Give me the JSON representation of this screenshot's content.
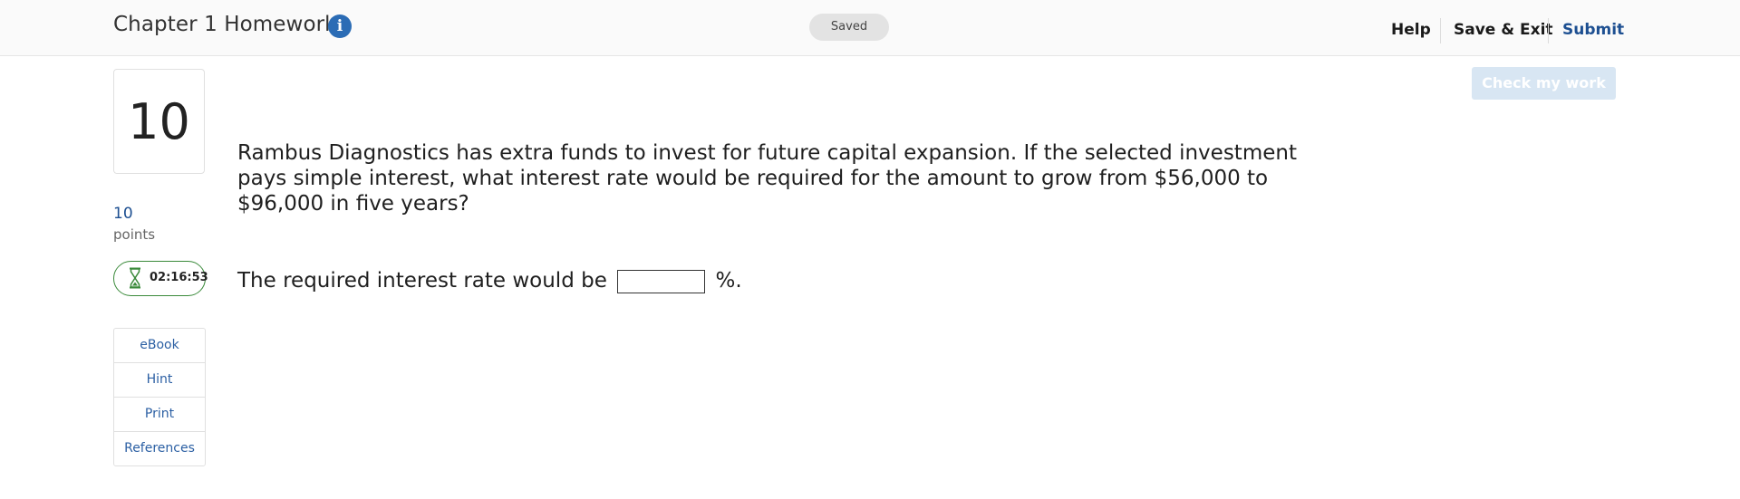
{
  "header": {
    "title": "Chapter 1 Homework",
    "info_icon": "info-icon",
    "status": "Saved",
    "links": {
      "help": "Help",
      "save_exit": "Save & Exit",
      "submit": "Submit"
    }
  },
  "question_panel": {
    "number": "10",
    "points_value": "10",
    "points_label": "points",
    "timer": "02:16:53",
    "timer_icon": "hourglass-icon",
    "tools": [
      "eBook",
      "Hint",
      "Print",
      "References"
    ]
  },
  "check_button": "Check my work",
  "question": {
    "text": "Rambus Diagnostics has extra funds to invest for future capital expansion. If the selected investment pays simple interest, what interest rate would be required for the amount to grow from $56,000 to $96,000 in five years?",
    "answer_prefix": "The required interest rate would be",
    "answer_value": "",
    "answer_suffix": "%."
  },
  "colors": {
    "accent_blue": "#1d4f91",
    "link_blue": "#2b5fa3",
    "info_blue": "#2b6cb5",
    "timer_green": "#3a8a3a",
    "check_button_bg": "#d8e6f3"
  }
}
